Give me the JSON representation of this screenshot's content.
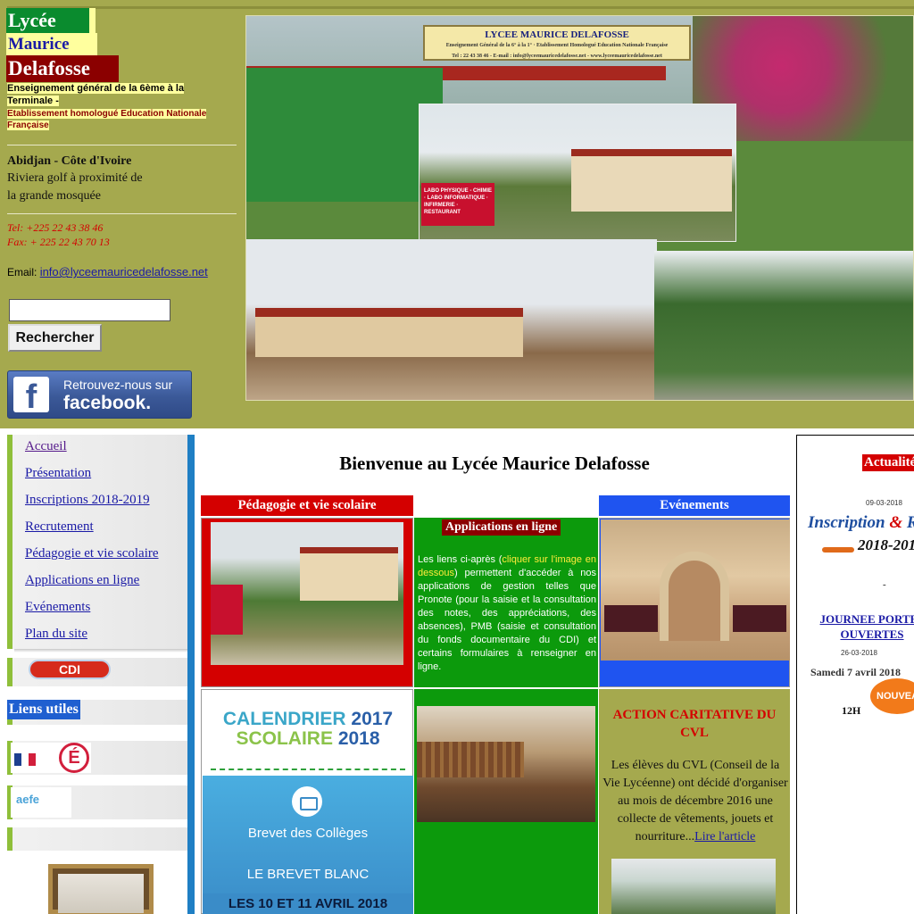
{
  "header": {
    "title_line_1": "Lycée",
    "title_line_2": "Maurice",
    "title_line_3": "Delafosse",
    "subtitle_1": "Enseignement général de la 6ème à la Terminale  -",
    "subtitle_2": "Etablissement homologué Education Nationale Française",
    "city": "Abidjan - Côte d'Ivoire",
    "address_1": "Riviera golf à proximité de",
    "address_2": "la grande mosquée",
    "tel": "Tel: +225 22 43 38 46",
    "fax": "Fax: + 225 22 43 70 13",
    "email_label": "Email:",
    "email": "info@lyceemauricedelafosse.net",
    "search_value": "",
    "search_button": "Rechercher",
    "facebook_line_1": "Retrouvez-nous sur",
    "facebook_line_2": "facebook.",
    "facebook_logo": "f",
    "photo_sign_title": "LYCEE MAURICE DELAFOSSE",
    "photo_sign_sub": "Enseignement Général de la 6° à la 1° · Etablissement Homologué Education Nationale Française",
    "photo_sign_small": "Tel : 22 43 38 46 - E-mail : info@lyceemauricedelafosse.net - www.lyceemauricedelafosse.net",
    "photo_sign_2": "LABO PHYSIQUE - CHIMIE · LABO INFORMATIQUE · INFIRMERIE · RESTAURANT"
  },
  "nav": {
    "items": [
      {
        "label": "Accueil"
      },
      {
        "label": "Présentation"
      },
      {
        "label": "Inscriptions 2018-2019"
      },
      {
        "label": "Recrutement"
      },
      {
        "label": "Pédagogie et vie scolaire"
      },
      {
        "label": "Applications en ligne"
      },
      {
        "label": "Evénements"
      },
      {
        "label": "Plan du site"
      }
    ],
    "cdi_label": "CDI",
    "liens_utiles": "Liens utiles",
    "ministere_logo_text": "É",
    "aefe_logo_text": "aefe"
  },
  "main": {
    "welcome": "Bienvenue au Lycée Maurice Delafosse",
    "col_peda_title": "Pédagogie et vie scolaire",
    "col_evt_title": "Evénements",
    "apps_title": "Applications en ligne",
    "apps_text_1": "Les liens ci-après (",
    "apps_text_link": "cliquer sur l'image en dessous",
    "apps_text_2": ") permettent d'accéder à nos applications de gestion telles que Pronote (pour la saisie et la consultation des notes, des appréciations, des absences), PMB (saisie et consultation du fonds documentaire du CDI) et certains formulaires à renseigner en ligne.",
    "calendar_word_1": "CALENDRIER",
    "calendar_year_1": "2017",
    "calendar_word_2": "SCOLAIRE",
    "calendar_year_2": "2018",
    "brevet": "Brevet des Collèges",
    "brevet_blanc": "LE BREVET BLANC",
    "brevet_dates": "LES 10 ET 11 AVRIL 2018",
    "action_title": "ACTION CARITATIVE DU CVL",
    "action_text": "Les élèves du CVL (Conseil de la Vie Lycéenne) ont décidé d'organiser au mois de décembre 2016 une collecte de vêtements, jouets et nourriture...",
    "action_link": "Lire l'article"
  },
  "news": {
    "title": "Actualités",
    "date_1": "09-03-2018",
    "insc_line_1a": "Inscription",
    "insc_amp": "&",
    "insc_line_1b": "Réi",
    "insc_line_2": "2018-201",
    "dash": "-",
    "jpo_link": "JOURNEE PORTES OUVERTES",
    "date_2": "26-03-2018",
    "samedi": "Samedi 7 avril 2018",
    "heure": "12H",
    "nouveau": "NOUVEAU"
  },
  "colors": {
    "olive": "#a5a94e",
    "green": "#0c9a0c",
    "red": "#d40000",
    "blue": "#1f54f0",
    "link": "#1a1aa6"
  }
}
